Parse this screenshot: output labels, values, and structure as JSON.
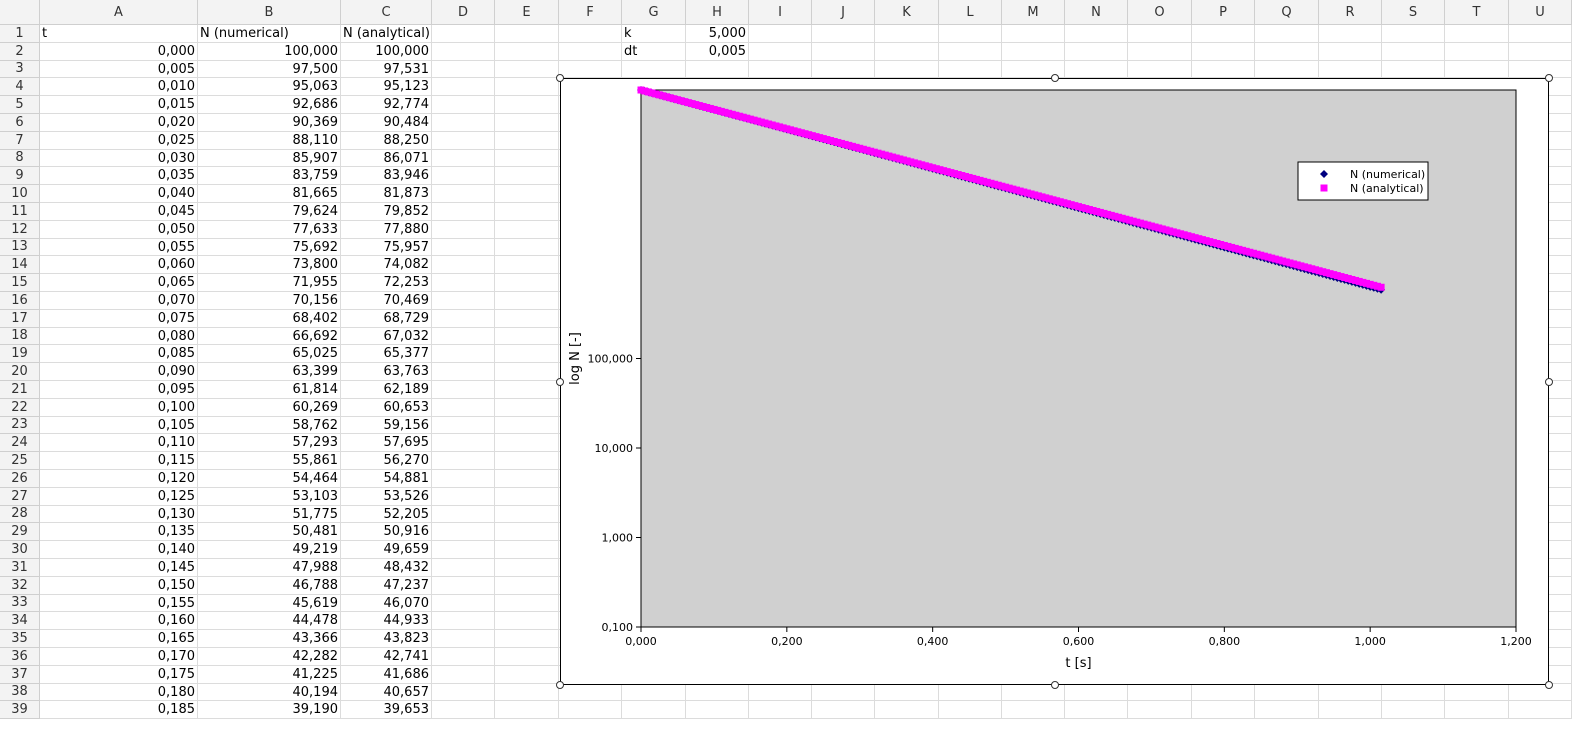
{
  "sheet": {
    "columns": [
      "A",
      "B",
      "C",
      "D",
      "E",
      "F",
      "G",
      "H",
      "I",
      "J",
      "K",
      "L",
      "M",
      "N",
      "O",
      "P",
      "Q",
      "R",
      "S",
      "T",
      "U"
    ],
    "rows": [
      "1",
      "2",
      "3",
      "4",
      "5",
      "6",
      "7",
      "8",
      "9",
      "10",
      "11",
      "12",
      "13",
      "14",
      "15",
      "16",
      "17",
      "18",
      "19",
      "20",
      "21",
      "22",
      "23",
      "24",
      "25",
      "26",
      "27",
      "28",
      "29",
      "30",
      "31",
      "32",
      "33",
      "34",
      "35",
      "36",
      "37",
      "38",
      "39"
    ],
    "headers": {
      "t": "t",
      "numerical": "N (numerical)",
      "analytical": "N (analytical)"
    },
    "params": {
      "k_label": "k",
      "k_value": "5,000",
      "dt_label": "dt",
      "dt_value": "0,005"
    },
    "data": [
      [
        "0,000",
        "100,000",
        "100,000"
      ],
      [
        "0,005",
        "97,500",
        "97,531"
      ],
      [
        "0,010",
        "95,063",
        "95,123"
      ],
      [
        "0,015",
        "92,686",
        "92,774"
      ],
      [
        "0,020",
        "90,369",
        "90,484"
      ],
      [
        "0,025",
        "88,110",
        "88,250"
      ],
      [
        "0,030",
        "85,907",
        "86,071"
      ],
      [
        "0,035",
        "83,759",
        "83,946"
      ],
      [
        "0,040",
        "81,665",
        "81,873"
      ],
      [
        "0,045",
        "79,624",
        "79,852"
      ],
      [
        "0,050",
        "77,633",
        "77,880"
      ],
      [
        "0,055",
        "75,692",
        "75,957"
      ],
      [
        "0,060",
        "73,800",
        "74,082"
      ],
      [
        "0,065",
        "71,955",
        "72,253"
      ],
      [
        "0,070",
        "70,156",
        "70,469"
      ],
      [
        "0,075",
        "68,402",
        "68,729"
      ],
      [
        "0,080",
        "66,692",
        "67,032"
      ],
      [
        "0,085",
        "65,025",
        "65,377"
      ],
      [
        "0,090",
        "63,399",
        "63,763"
      ],
      [
        "0,095",
        "61,814",
        "62,189"
      ],
      [
        "0,100",
        "60,269",
        "60,653"
      ],
      [
        "0,105",
        "58,762",
        "59,156"
      ],
      [
        "0,110",
        "57,293",
        "57,695"
      ],
      [
        "0,115",
        "55,861",
        "56,270"
      ],
      [
        "0,120",
        "54,464",
        "54,881"
      ],
      [
        "0,125",
        "53,103",
        "53,526"
      ],
      [
        "0,130",
        "51,775",
        "52,205"
      ],
      [
        "0,135",
        "50,481",
        "50,916"
      ],
      [
        "0,140",
        "49,219",
        "49,659"
      ],
      [
        "0,145",
        "47,988",
        "48,432"
      ],
      [
        "0,150",
        "46,788",
        "47,237"
      ],
      [
        "0,155",
        "45,619",
        "46,070"
      ],
      [
        "0,160",
        "44,478",
        "44,933"
      ],
      [
        "0,165",
        "43,366",
        "43,823"
      ],
      [
        "0,170",
        "42,282",
        "42,741"
      ],
      [
        "0,175",
        "41,225",
        "41,686"
      ],
      [
        "0,180",
        "40,194",
        "40,657"
      ],
      [
        "0,185",
        "39,190",
        "39,653"
      ]
    ]
  },
  "chart_data": {
    "type": "scatter",
    "xlabel": "t [s]",
    "ylabel": "log N [-]",
    "xlim": [
      0,
      1.2
    ],
    "ylim": [
      0.1,
      100000
    ],
    "yscale": "log",
    "xticks": [
      "0,000",
      "0,200",
      "0,400",
      "0,600",
      "0,800",
      "1,000",
      "1,200"
    ],
    "yticks": [
      "0,100",
      "1,000",
      "10,000",
      "100,000"
    ],
    "legend_position": "top-right",
    "plot_background": "#d0d0d0",
    "series": [
      {
        "name": "N (numerical)",
        "color": "#000080",
        "marker": "diamond",
        "k": 5,
        "dt": 0.005,
        "t_start": 0,
        "t_end": 1.015,
        "N0": 100000,
        "method": "explicit-euler"
      },
      {
        "name": "N (analytical)",
        "color": "#ff00ff",
        "marker": "square",
        "k": 5,
        "dt": 0.005,
        "t_start": 0,
        "t_end": 1.015,
        "N0": 100000,
        "method": "exact-exponential"
      }
    ]
  }
}
